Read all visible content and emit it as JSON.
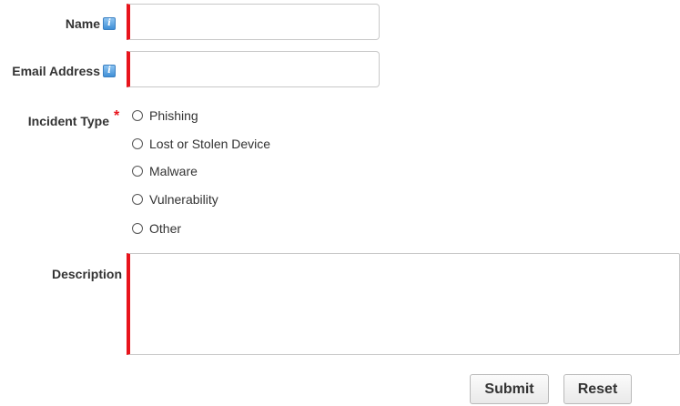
{
  "form": {
    "name": {
      "label": "Name",
      "value": "",
      "help_icon": "info-icon"
    },
    "email": {
      "label": "Email Address",
      "value": "",
      "help_icon": "info-icon"
    },
    "incident_type": {
      "label": "Incident Type",
      "required_marker": "*",
      "options": [
        "Phishing",
        "Lost or Stolen Device",
        "Malware",
        "Vulnerability",
        "Other"
      ],
      "selected": null
    },
    "description": {
      "label": "Description",
      "value": ""
    },
    "buttons": {
      "submit": "Submit",
      "reset": "Reset"
    }
  },
  "colors": {
    "required_accent": "#e8141c",
    "help_icon": "#3f8fd6",
    "label_text": "#333333"
  }
}
